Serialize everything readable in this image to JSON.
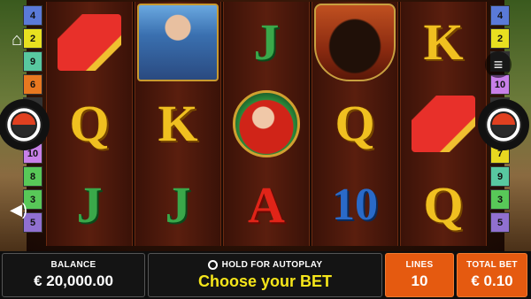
{
  "reels": [
    [
      "cape",
      "Q",
      "J"
    ],
    [
      "matador",
      "K",
      "J"
    ],
    [
      "J",
      "lady",
      "A"
    ],
    [
      "bull",
      "Q",
      "10"
    ],
    [
      "K",
      "cape",
      "Q"
    ]
  ],
  "left_numbers": [
    {
      "label": "4",
      "color": "#5a7ad8"
    },
    {
      "label": "2",
      "color": "#e8e020"
    },
    {
      "label": "9",
      "color": "#58c8a0"
    },
    {
      "label": "6",
      "color": "#e87820"
    },
    {
      "label": "",
      "color": "#333333"
    },
    {
      "label": "",
      "color": "#333333"
    },
    {
      "label": "10",
      "color": "#c880e8"
    },
    {
      "label": "8",
      "color": "#58c858"
    },
    {
      "label": "3",
      "color": "#58c858"
    },
    {
      "label": "5",
      "color": "#9070d0"
    }
  ],
  "right_numbers": [
    {
      "label": "4",
      "color": "#5a7ad8"
    },
    {
      "label": "2",
      "color": "#e8e020"
    },
    {
      "label": "",
      "color": "#333333"
    },
    {
      "label": "10",
      "color": "#c880e8"
    },
    {
      "label": "",
      "color": "#333333"
    },
    {
      "label": "",
      "color": "#333333"
    },
    {
      "label": "7",
      "color": "#e8d820"
    },
    {
      "label": "9",
      "color": "#58c8a0"
    },
    {
      "label": "3",
      "color": "#58c858"
    },
    {
      "label": "5",
      "color": "#9070d0"
    }
  ],
  "controls": {
    "home_icon": "home-icon",
    "sound_icon": "speaker-icon",
    "menu_icon": "hamburger-menu-icon"
  },
  "bottom": {
    "balance_label": "BALANCE",
    "balance_value": "€ 20,000.00",
    "autoplay_label": "HOLD FOR AUTOPLAY",
    "center_text": "Choose your BET",
    "lines_label": "LINES",
    "lines_value": "10",
    "total_bet_label": "TOTAL BET",
    "total_bet_value": "€ 0.10"
  }
}
